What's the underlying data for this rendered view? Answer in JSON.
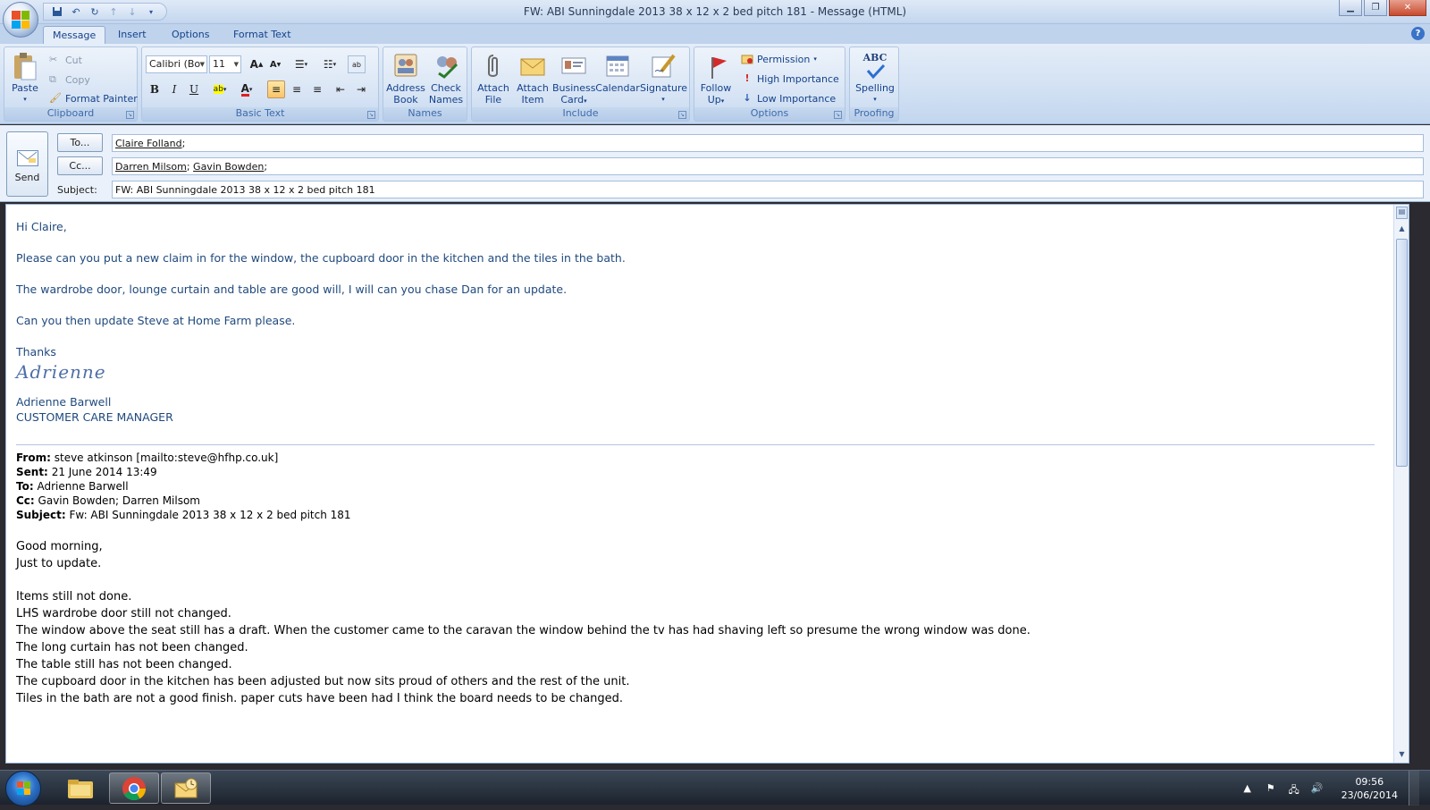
{
  "window": {
    "title": "FW: ABI Sunningdale 2013 38 x 12 x 2 bed pitch 181  -  Message (HTML)"
  },
  "tabs": [
    "Message",
    "Insert",
    "Options",
    "Format Text"
  ],
  "ribbon": {
    "clipboard": {
      "label": "Clipboard",
      "paste": "Paste",
      "cut": "Cut",
      "copy": "Copy",
      "format_painter": "Format Painter"
    },
    "basic_text": {
      "label": "Basic Text",
      "font": "Calibri (Bo",
      "size": "11"
    },
    "names": {
      "label": "Names",
      "address_book": [
        "Address",
        "Book"
      ],
      "check_names": [
        "Check",
        "Names"
      ]
    },
    "include": {
      "label": "Include",
      "attach_file": [
        "Attach",
        "File"
      ],
      "attach_item": [
        "Attach",
        "Item"
      ],
      "business_card": [
        "Business",
        "Card"
      ],
      "calendar": "Calendar",
      "signature": "Signature"
    },
    "options": {
      "label": "Options",
      "follow_up": [
        "Follow",
        "Up"
      ],
      "permission": "Permission",
      "high_importance": "High Importance",
      "low_importance": "Low Importance"
    },
    "proofing": {
      "label": "Proofing",
      "spelling": "Spelling",
      "abc": "ABC"
    }
  },
  "header": {
    "send": "Send",
    "to_button": "To...",
    "cc_button": "Cc...",
    "subject_label": "Subject:",
    "to": "Claire Folland",
    "cc": [
      "Darren Milsom",
      "Gavin Bowden"
    ],
    "subject": "FW: ABI Sunningdale 2013 38 x 12 x 2 bed pitch 181"
  },
  "message": {
    "greeting": "Hi Claire,",
    "p1": "Please can you put a new claim in for the window, the cupboard door in the kitchen and the tiles in the bath.",
    "p2": "The wardrobe door, lounge curtain and table are good will, I will can you chase Dan for an update.",
    "p3": "Can you then update Steve at Home Farm please.",
    "thanks": "Thanks",
    "signature_script": "Adrienne",
    "sig_name": "Adrienne Barwell",
    "sig_title": "CUSTOMER CARE MANAGER"
  },
  "forwarded": {
    "from_label": "From:",
    "from": "steve atkinson [mailto:steve@hfhp.co.uk]",
    "sent_label": "Sent:",
    "sent": "21 June 2014 13:49",
    "to_label": "To:",
    "to": "Adrienne Barwell",
    "cc_label": "Cc:",
    "cc": "Gavin Bowden; Darren Milsom",
    "subject_label": "Subject:",
    "subject": "Fw: ABI Sunningdale 2013 38 x 12 x 2 bed pitch 181",
    "lines_a": [
      "Good morning,",
      "Just to update."
    ],
    "lines_b": [
      "Items still not done.",
      "LHS wardrobe door still not changed.",
      "The window above the seat still has a draft. When the customer came to the caravan the window behind the tv has had shaving left so presume the wrong window was done.",
      "The long curtain has not been changed.",
      "The table still has not been changed.",
      "The cupboard door in the kitchen has been adjusted but now sits proud of others and the rest of the unit.",
      "Tiles in the bath are not a good finish. paper cuts have been had I think the board needs to be changed."
    ]
  },
  "taskbar": {
    "apps": [
      "explorer-icon",
      "chrome-icon",
      "outlook-icon"
    ],
    "time": "09:56",
    "date": "23/06/2014"
  },
  "colors": {
    "ribbon_text": "#15428b",
    "message_blue": "#1f497d",
    "tab_active_bg": "#e4edf8"
  }
}
